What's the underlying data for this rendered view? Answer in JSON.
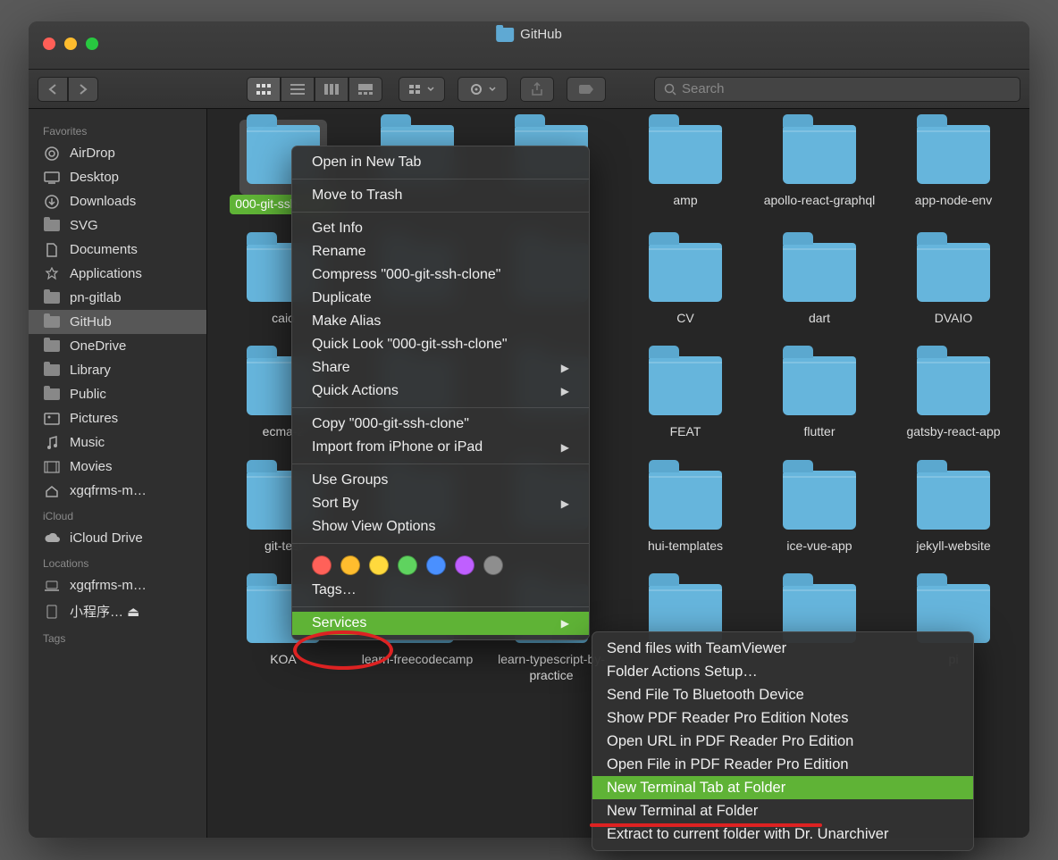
{
  "window": {
    "title": "GitHub"
  },
  "search": {
    "placeholder": "Search"
  },
  "sidebar": {
    "sections": [
      {
        "title": "Favorites",
        "items": [
          {
            "icon": "airdrop-icon",
            "label": "AirDrop"
          },
          {
            "icon": "desktop-icon",
            "label": "Desktop"
          },
          {
            "icon": "downloads-icon",
            "label": "Downloads"
          },
          {
            "icon": "folder-icon",
            "label": "SVG"
          },
          {
            "icon": "documents-icon",
            "label": "Documents"
          },
          {
            "icon": "applications-icon",
            "label": "Applications"
          },
          {
            "icon": "folder-icon",
            "label": "pn-gitlab"
          },
          {
            "icon": "folder-icon",
            "label": "GitHub",
            "selected": true
          },
          {
            "icon": "folder-icon",
            "label": "OneDrive"
          },
          {
            "icon": "folder-icon",
            "label": "Library"
          },
          {
            "icon": "folder-icon",
            "label": "Public"
          },
          {
            "icon": "pictures-icon",
            "label": "Pictures"
          },
          {
            "icon": "music-icon",
            "label": "Music"
          },
          {
            "icon": "movies-icon",
            "label": "Movies"
          },
          {
            "icon": "home-icon",
            "label": "xgqfrms-m…"
          }
        ]
      },
      {
        "title": "iCloud",
        "items": [
          {
            "icon": "cloud-icon",
            "label": "iCloud Drive"
          }
        ]
      },
      {
        "title": "Locations",
        "items": [
          {
            "icon": "laptop-icon",
            "label": "xgqfrms-m…"
          },
          {
            "icon": "disk-icon",
            "label": "小程序… ⏏"
          }
        ]
      },
      {
        "title": "Tags",
        "items": []
      }
    ]
  },
  "grid": [
    {
      "label": "000-git-ssh-clone",
      "selected": true
    },
    {
      "label": ""
    },
    {
      "label": ""
    },
    {
      "label": "amp"
    },
    {
      "label": "apollo-react-graphql"
    },
    {
      "label": "app-node-env"
    },
    {
      "label": "caio"
    },
    {
      "label": ""
    },
    {
      "label": ""
    },
    {
      "label": "CV"
    },
    {
      "label": "dart"
    },
    {
      "label": "DVAIO"
    },
    {
      "label": "ecma-2"
    },
    {
      "label": ""
    },
    {
      "label": ""
    },
    {
      "label": "FEAT"
    },
    {
      "label": "flutter"
    },
    {
      "label": "gatsby-react-app"
    },
    {
      "label": "git-test"
    },
    {
      "label": ""
    },
    {
      "label": ""
    },
    {
      "label": "hui-templates"
    },
    {
      "label": "ice-vue-app"
    },
    {
      "label": "jekyll-website"
    },
    {
      "label": "KOA"
    },
    {
      "label": "learn-freecodecamp"
    },
    {
      "label": "learn-typescript-by-practice"
    },
    {
      "label": ""
    },
    {
      "label": ""
    },
    {
      "label": "pi"
    }
  ],
  "context_menu": {
    "groups": [
      [
        {
          "label": "Open in New Tab"
        }
      ],
      [
        {
          "label": "Move to Trash"
        }
      ],
      [
        {
          "label": "Get Info"
        },
        {
          "label": "Rename"
        },
        {
          "label": "Compress \"000-git-ssh-clone\""
        },
        {
          "label": "Duplicate"
        },
        {
          "label": "Make Alias"
        },
        {
          "label": "Quick Look \"000-git-ssh-clone\""
        },
        {
          "label": "Share",
          "submenu": true
        },
        {
          "label": "Quick Actions",
          "submenu": true
        }
      ],
      [
        {
          "label": "Copy \"000-git-ssh-clone\""
        },
        {
          "label": "Import from iPhone or iPad",
          "submenu": true
        }
      ],
      [
        {
          "label": "Use Groups"
        },
        {
          "label": "Sort By",
          "submenu": true
        },
        {
          "label": "Show View Options"
        }
      ]
    ],
    "tag_colors": [
      "#ff6159",
      "#ffbd2e",
      "#ffd93d",
      "#5fd35f",
      "#4a90ff",
      "#bf5fff",
      "#8e8e8e"
    ],
    "tags_label": "Tags…",
    "footer": {
      "label": "Services",
      "submenu": true,
      "highlighted": true
    }
  },
  "services_submenu": [
    {
      "label": "Send files with TeamViewer"
    },
    {
      "label": "Folder Actions Setup…"
    },
    {
      "label": "Send File To Bluetooth Device"
    },
    {
      "label": "Show PDF Reader Pro Edition Notes"
    },
    {
      "label": "Open URL in PDF Reader Pro Edition"
    },
    {
      "label": "Open File in PDF Reader Pro Edition"
    },
    {
      "label": "New Terminal Tab at Folder",
      "highlighted": true
    },
    {
      "label": "New Terminal at Folder"
    },
    {
      "label": "Extract to current folder with Dr. Unarchiver"
    }
  ]
}
